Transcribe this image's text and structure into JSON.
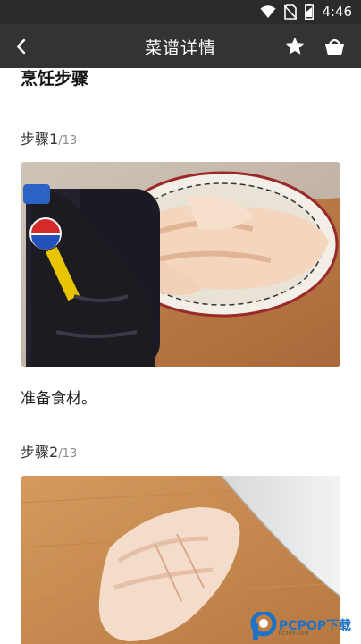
{
  "status_bar": {
    "time": "4:46",
    "icons": [
      "wifi-icon",
      "no-sim-icon",
      "battery-icon"
    ]
  },
  "app_bar": {
    "title": "菜谱详情",
    "icons": [
      "back-arrow-icon",
      "star-icon",
      "basket-icon"
    ]
  },
  "content": {
    "section_title": "烹饪步骤",
    "steps": [
      {
        "label": "步骤1",
        "total": "/13",
        "description": "准备食材。"
      },
      {
        "label": "步骤2",
        "total": "/13",
        "description": ""
      }
    ]
  },
  "watermark": {
    "brand": "PCPOP",
    "brand_suffix": "下载",
    "tagline": "PCPOP.COM"
  },
  "colors": {
    "status_bar": "#2b2b2b",
    "app_bar": "#333333",
    "watermark": "#1e73c8"
  }
}
